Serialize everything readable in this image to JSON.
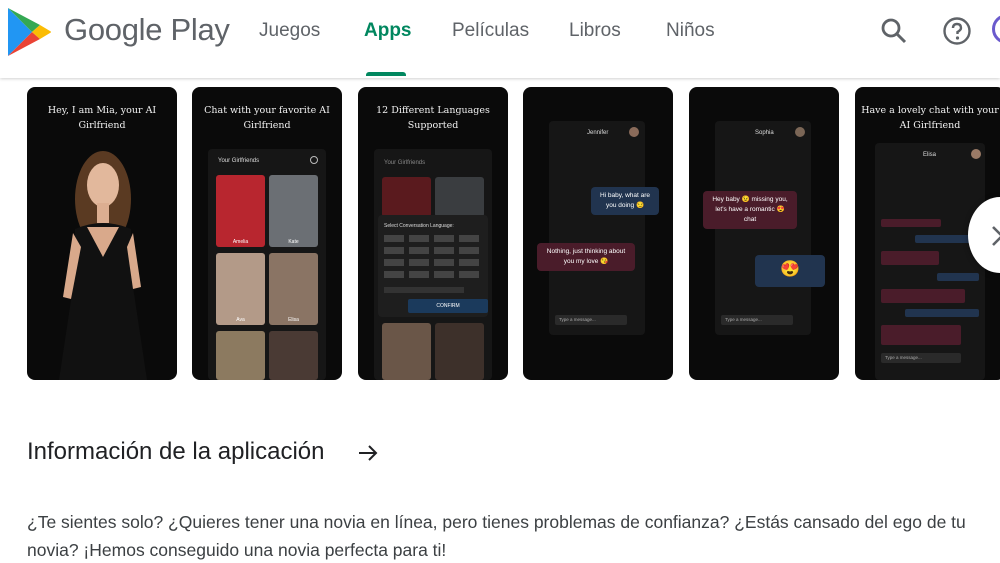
{
  "header": {
    "brand": "Google Play",
    "nav": [
      "Juegos",
      "Apps",
      "Películas",
      "Libros",
      "Niños"
    ],
    "active_nav": "Apps",
    "icons": [
      "search-icon",
      "help-icon"
    ]
  },
  "screenshots": [
    {
      "caption": "Hey, I am Mia, your AI Girlfriend"
    },
    {
      "caption": "Chat with your favorite AI Girlfriend",
      "list_title": "Your Girlfriends",
      "names": [
        "Amelia",
        "Kate",
        "Ava",
        "Elisa"
      ]
    },
    {
      "caption": "12 Different Languages Supported",
      "list_title": "Your Girlfriends",
      "dialog_title": "Select Conversation Language:",
      "confirm": "CONFIRM"
    },
    {
      "contact": "Jennifer",
      "msg_user": "Hi baby, what are you doing 😏",
      "msg_bot": "Nothing, just thinking about you my love 😘",
      "input": "Type a message..."
    },
    {
      "contact": "Sophia",
      "msg_bot": "Hey baby 😉 missing you, let's have a romantic 😍 chat",
      "emoji": "😍",
      "input": "Type a message..."
    },
    {
      "caption": "Have a lovely chat with your AI Girlfriend",
      "contact": "Elisa",
      "input": "Type a message..."
    }
  ],
  "info": {
    "title": "Información de la aplicación",
    "description": "¿Te sientes solo? ¿Quieres tener una novia en línea, pero tienes problemas de confianza? ¿Estás cansado del ego de tu novia? ¡Hemos conseguido una novia perfecta para ti!"
  },
  "colors": {
    "accent": "#01875f",
    "text": "#202124",
    "secondary": "#5f6368"
  }
}
